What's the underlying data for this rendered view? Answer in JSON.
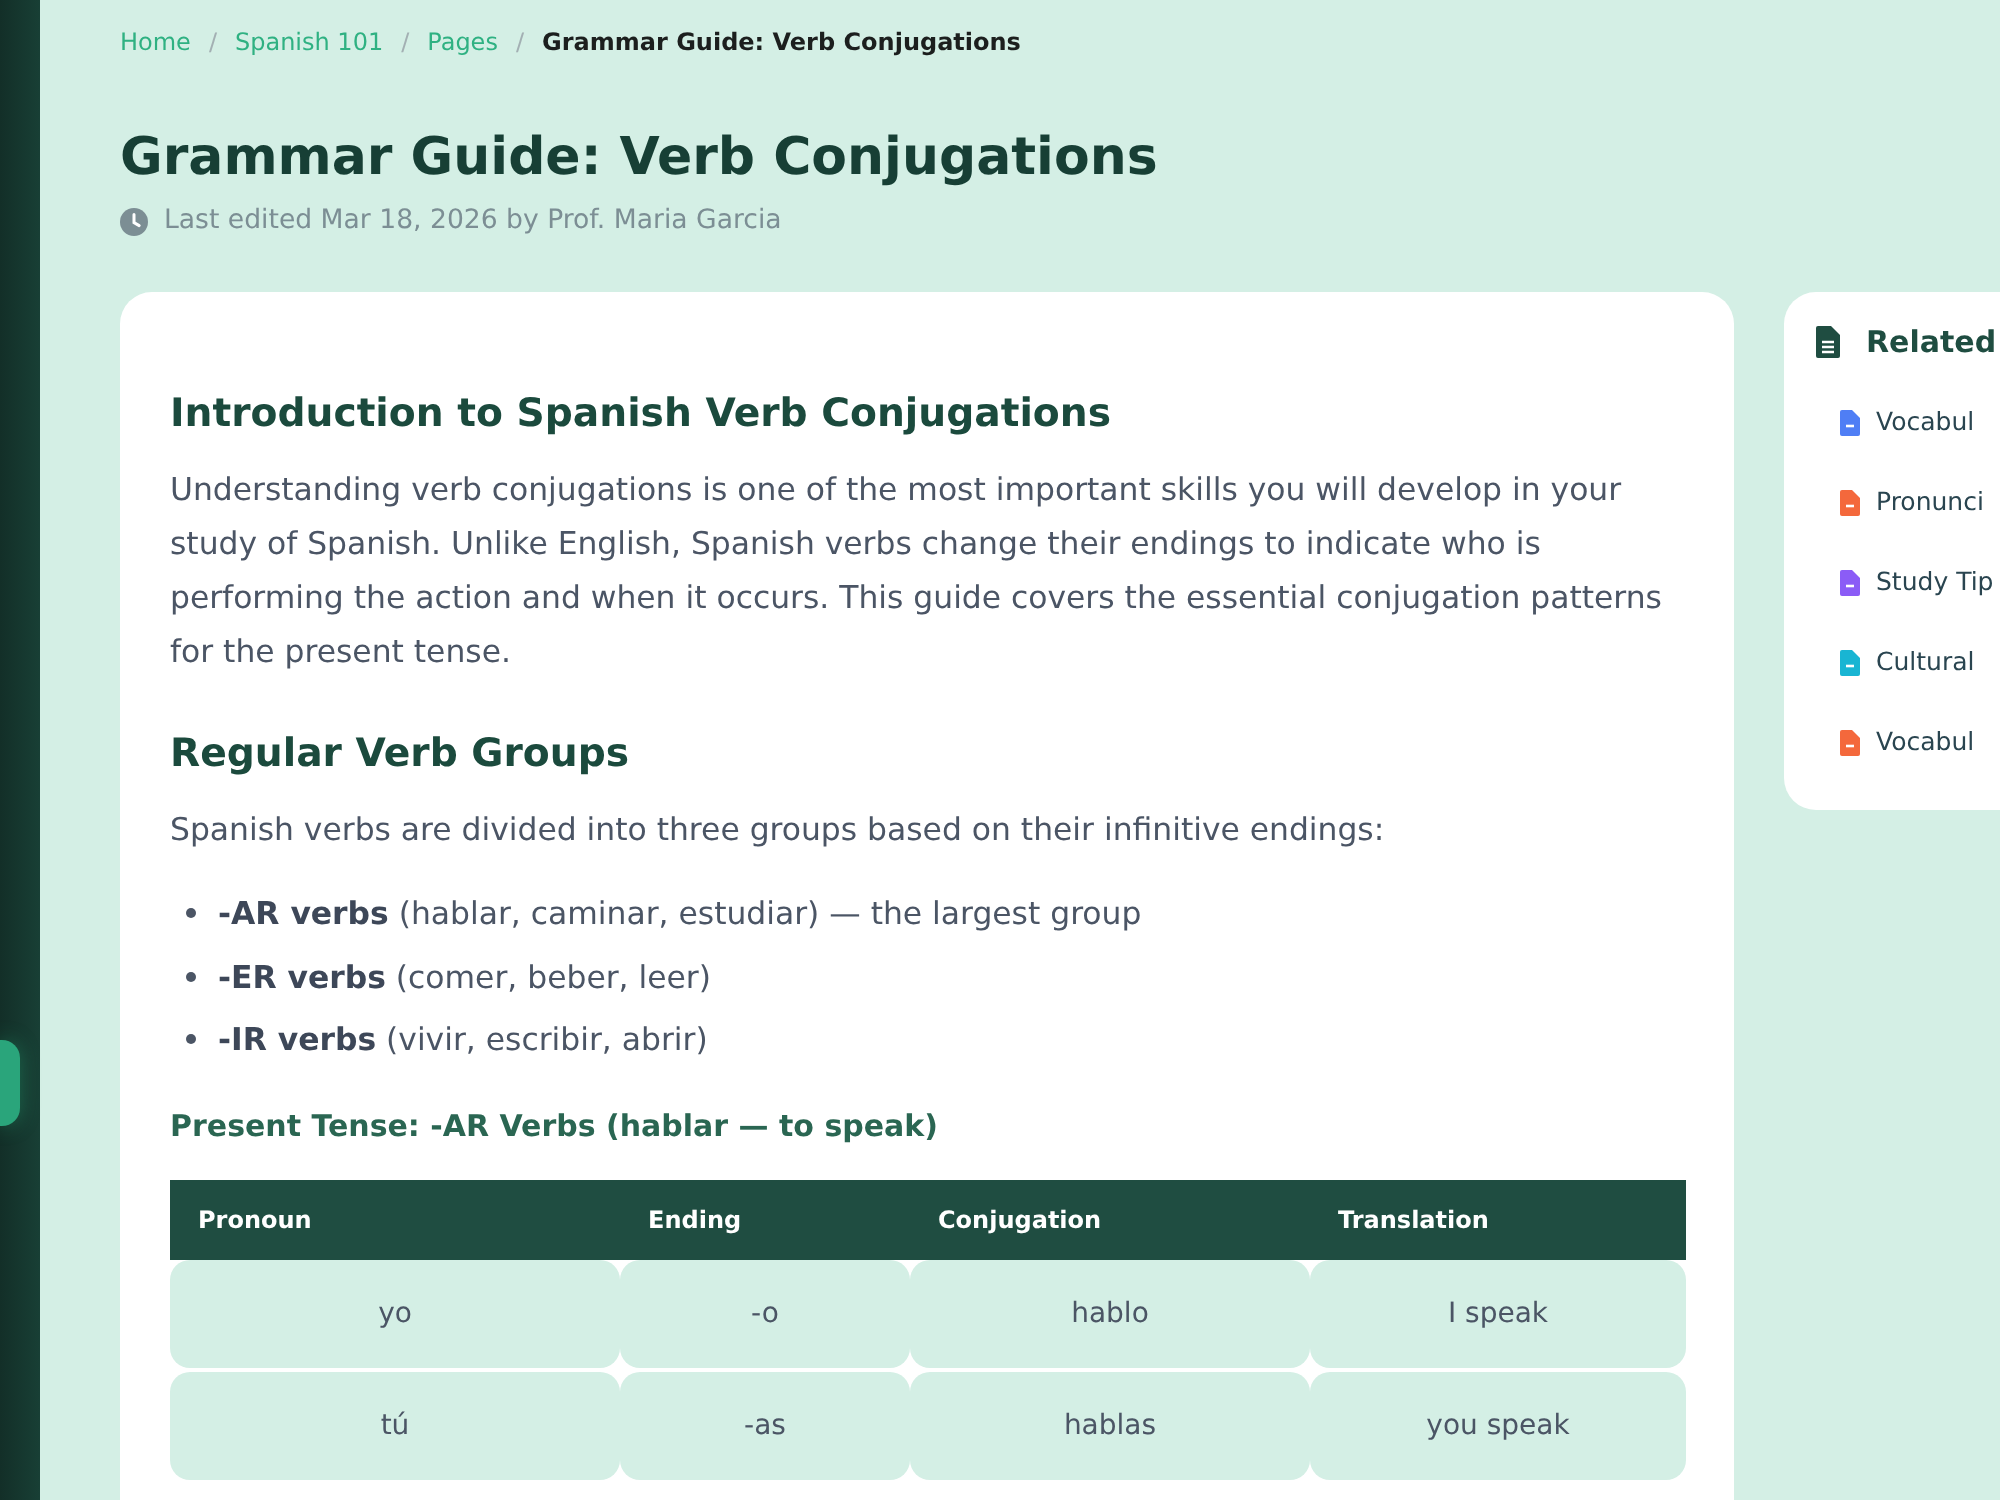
{
  "breadcrumb": [
    {
      "kind": "link",
      "label": "Home"
    },
    {
      "kind": "separator",
      "label": "/"
    },
    {
      "kind": "link",
      "label": "Spanish 101"
    },
    {
      "kind": "separator",
      "label": "/"
    },
    {
      "kind": "link",
      "label": "Pages"
    },
    {
      "kind": "separator",
      "label": "/"
    },
    {
      "kind": "current",
      "label": "Grammar Guide: Verb Conjugations"
    }
  ],
  "page": {
    "title": "Grammar Guide: Verb Conjugations",
    "last_edited": "Last edited Mar 18, 2026 by Prof. Maria Garcia"
  },
  "article": {
    "blocks": [
      {
        "kind": "heading",
        "text": "Introduction to Spanish Verb Conjugations"
      },
      {
        "kind": "paragraph",
        "text": "Understanding verb conjugations is one of the most important skills you will develop in your study of Spanish. Unlike English, Spanish verbs change their endings to indicate who is performing the action and when it occurs. This guide covers the essential conjugation patterns for the present tense."
      },
      {
        "kind": "heading",
        "text": "Regular Verb Groups"
      },
      {
        "kind": "paragraph",
        "text": "Spanish verbs are divided into three groups based on their infinitive endings:"
      },
      {
        "kind": "list",
        "items": [
          "**-AR verbs** (hablar, caminar, estudiar) — the largest group",
          "**-ER verbs** (comer, beber, leer)",
          "**-IR verbs** (vivir, escribir, abrir)"
        ]
      },
      {
        "kind": "subheading",
        "text": "Present Tense: -AR Verbs (hablar — to speak)"
      },
      {
        "kind": "table",
        "columns": [
          "Pronoun",
          "Ending",
          "Conjugation",
          "Translation"
        ],
        "rows": [
          [
            "yo",
            "-o",
            "hablo",
            "I speak"
          ],
          [
            "tú",
            "-as",
            "hablas",
            "you speak"
          ]
        ]
      }
    ]
  },
  "related": {
    "title": "Related",
    "pages": [
      {
        "title": "Vocabul",
        "color": "#4f7ef5"
      },
      {
        "title": "Pronunci",
        "color": "#f4683c"
      },
      {
        "title": "Study Tip",
        "color": "#8b5cf6"
      },
      {
        "title": "Cultural",
        "color": "#19b5d3"
      },
      {
        "title": "Vocabul",
        "color": "#f4683c"
      }
    ]
  }
}
